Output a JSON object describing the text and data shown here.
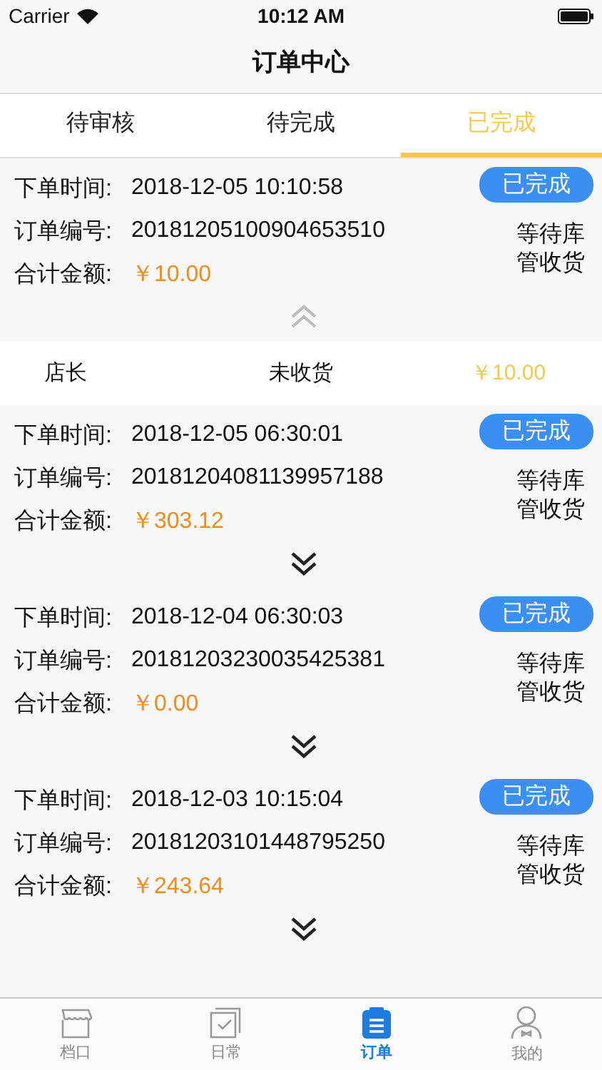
{
  "status_bar": {
    "carrier": "Carrier",
    "time": "10:12 AM"
  },
  "title": "订单中心",
  "tabs": [
    {
      "label": "待审核",
      "selected": false
    },
    {
      "label": "待完成",
      "selected": false
    },
    {
      "label": "已完成",
      "selected": true
    }
  ],
  "orders": [
    {
      "time_label": "下单时间:",
      "time": "2018-12-05 10:10:58",
      "number_label": "订单编号:",
      "number": "20181205100904653510",
      "amount_label": "合计金额:",
      "amount": "￥10.00",
      "status": "已完成",
      "note": "等待库管收货",
      "expanded": true,
      "details": [
        {
          "role": "店长",
          "state": "未收货",
          "amount": "￥10.00"
        }
      ]
    },
    {
      "time_label": "下单时间:",
      "time": "2018-12-05 06:30:01",
      "number_label": "订单编号:",
      "number": "20181204081139957188",
      "amount_label": "合计金额:",
      "amount": "￥303.12",
      "status": "已完成",
      "note": "等待库管收货",
      "expanded": false
    },
    {
      "time_label": "下单时间:",
      "time": "2018-12-04 06:30:03",
      "number_label": "订单编号:",
      "number": "20181203230035425381",
      "amount_label": "合计金额:",
      "amount": "￥0.00",
      "status": "已完成",
      "note": "等待库管收货",
      "expanded": false
    },
    {
      "time_label": "下单时间:",
      "time": "2018-12-03 10:15:04",
      "number_label": "订单编号:",
      "number": "20181203101448795250",
      "amount_label": "合计金额:",
      "amount": "￥243.64",
      "status": "已完成",
      "note": "等待库管收货",
      "expanded": false
    }
  ],
  "tab_bar": [
    {
      "label": "档口",
      "kind": "store",
      "selected": false
    },
    {
      "label": "日常",
      "kind": "calendar",
      "selected": false
    },
    {
      "label": "订单",
      "kind": "list",
      "selected": true
    },
    {
      "label": "我的",
      "kind": "person",
      "selected": false
    }
  ]
}
